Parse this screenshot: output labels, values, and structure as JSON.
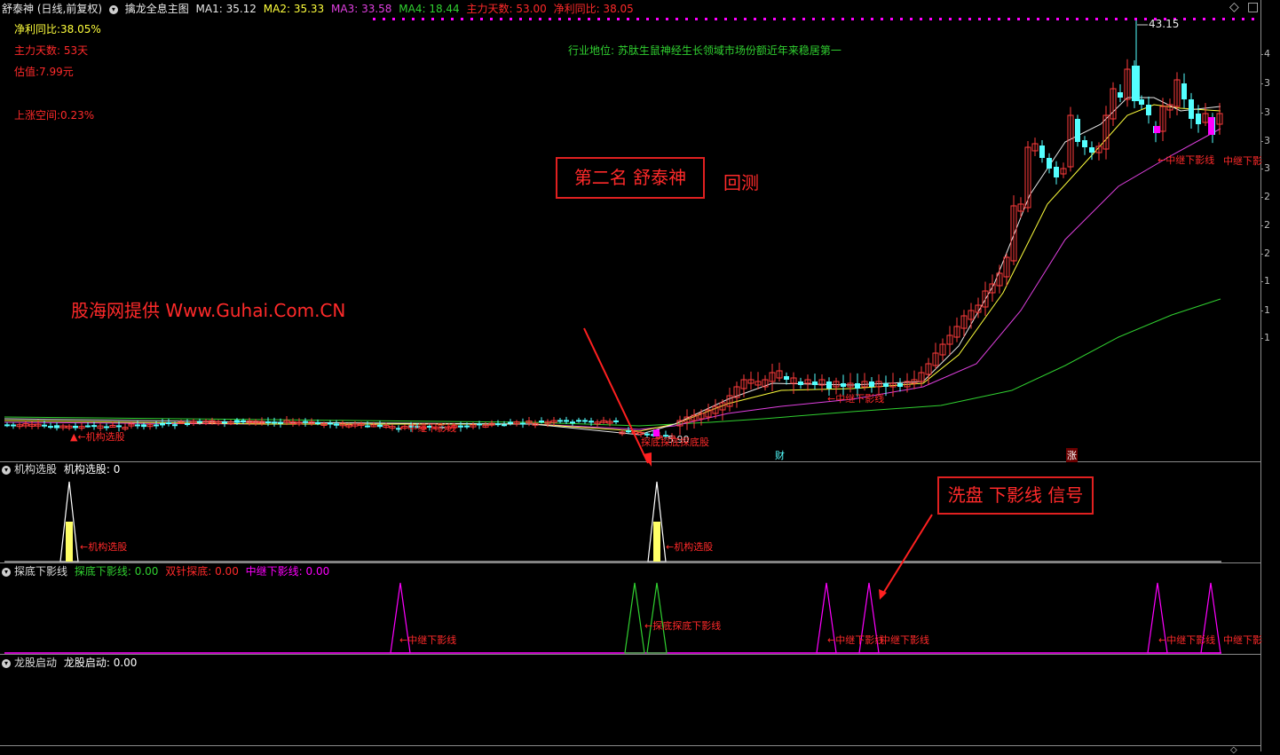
{
  "colors": {
    "ma1": "#e8e8e8",
    "ma2": "#ffff3c",
    "ma3": "#e040e0",
    "ma4": "#30d030",
    "up": "#ff3c3c",
    "down": "#54ffff",
    "text_red": "#ff2a2a",
    "magenta": "#ff00ff"
  },
  "header": {
    "stock": "舒泰神",
    "period": "(日线,前复权)",
    "indicator": "擒龙全息主图",
    "ma1": "MA1: 35.12",
    "ma2": "MA2: 35.33",
    "ma3": "MA3: 33.58",
    "ma4": "MA4: 18.44",
    "main_days": "主力天数: 53.00",
    "net_profit": "净利同比: 38.05"
  },
  "info": {
    "net_profit": "净利同比:38.05%",
    "main_days": "主力天数: 53天",
    "valuation": "估值:7.99元",
    "upside": "上涨空间:0.23%",
    "industry": "行业地位: 苏肽生鼠神经生长领域市场份额近年来稳居第一"
  },
  "annotations": {
    "title_box": "第二名 舒泰神",
    "backtest": "回测",
    "watermark": "股海网提供 Www.Guhai.Com.CN",
    "signal_box": "洗盘 下影线 信号",
    "high_price": "43.15",
    "low_price": "5.90",
    "inst_label_main": "←机构选股",
    "relay_1": "←中继下影线",
    "relay_2": "←中继下影线",
    "relay_3": "←中继下影线",
    "relay_end": "中继下影",
    "bottom_mix": "探底探底探底股",
    "badge_cai": "财",
    "badge_zhang": "涨"
  },
  "panel2": {
    "title": "机构选股",
    "value": "机构选股: 0",
    "label1": "←机构选股",
    "label2": "←机构选股"
  },
  "panel3": {
    "title": "探底下影线",
    "v1": "探底下影线: 0.00",
    "v2": "双针探底: 0.00",
    "v3": "中继下影线: 0.00",
    "label1": "←中继下影线",
    "label2": "←探底探底下影线",
    "label3": "←中继下影线",
    "label4": "中继下影线",
    "label5": "←中继下影线",
    "label6": "中继下影"
  },
  "panel4": {
    "title": "龙股启动",
    "value": "龙股启动: 0.00"
  },
  "axis": {
    "ticks": [
      "4",
      "3",
      "3",
      "3",
      "3",
      "2",
      "2",
      "2",
      "1",
      "1",
      "1"
    ]
  },
  "chart_data": [
    {
      "type": "candlestick",
      "name": "舒泰神 日线",
      "ma": {
        "MA1": 35.12,
        "MA2": 35.33,
        "MA3": 33.58,
        "MA4": 18.44
      },
      "high": 43.15,
      "low": 5.9,
      "candles": []
    },
    {
      "type": "line",
      "name": "机构选股",
      "spikes_x": [
        78,
        740
      ],
      "value": 0
    },
    {
      "type": "line",
      "name": "探底下影线",
      "series": [
        {
          "name": "探底下影线",
          "color": "#30d030",
          "spikes_x": [
            715,
            740
          ]
        },
        {
          "name": "中继下影线",
          "color": "#ff00ff",
          "spikes_x": [
            451,
            931,
            979,
            1304,
            1364
          ]
        }
      ]
    },
    {
      "type": "line",
      "name": "龙股启动",
      "value": 0
    }
  ]
}
